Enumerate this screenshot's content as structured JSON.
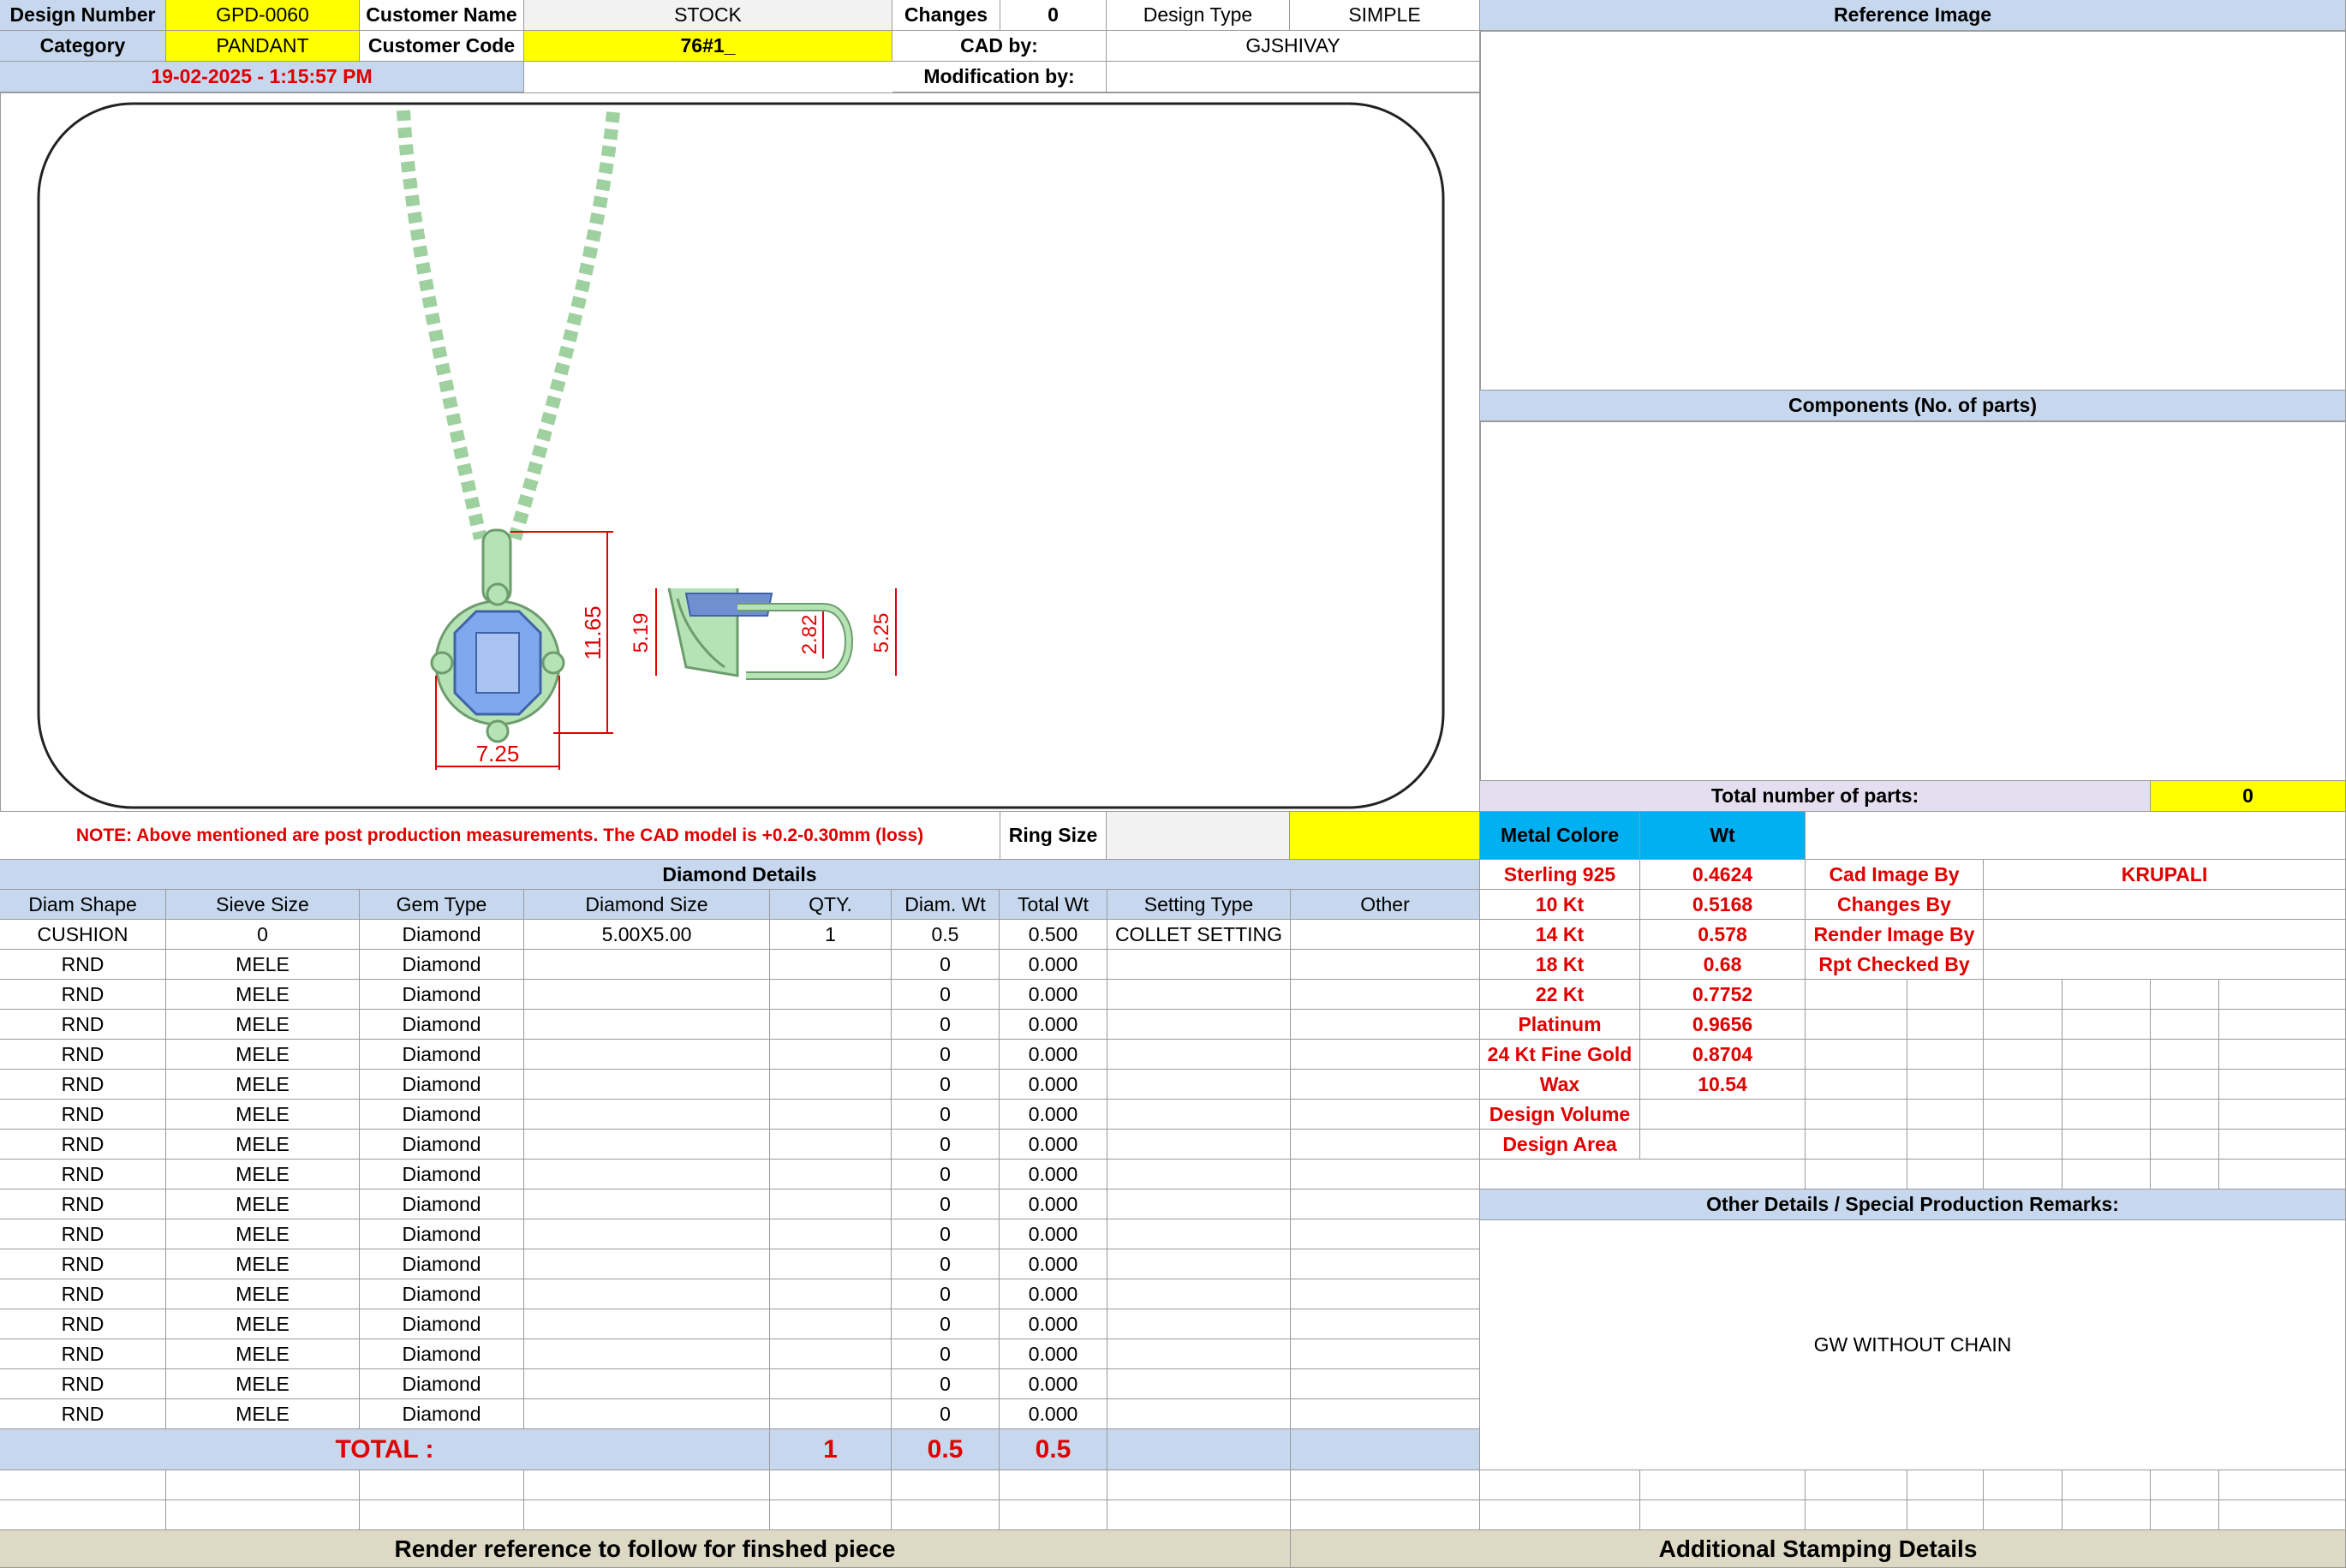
{
  "header": {
    "design_number_label": "Design Number",
    "design_number": "GPD-0060",
    "customer_name_label": "Customer Name",
    "customer_name": "STOCK",
    "changes_label": "Changes",
    "changes": "0",
    "design_type_label": "Design Type",
    "design_type": "SIMPLE",
    "category_label": "Category",
    "category": "PANDANT",
    "customer_code_label": "Customer Code",
    "customer_code": "76#1_",
    "cad_by_label": "CAD by:",
    "cad_by": "GJSHIVAY",
    "date": "19-02-2025 - 1:15:57 PM",
    "modification_by_label": "Modification by:"
  },
  "right_panel": {
    "reference_image_title": "Reference Image",
    "components_title": "Components (No. of parts)",
    "total_parts_label": "Total number of parts:",
    "total_parts": "0"
  },
  "measurements": {
    "width": "7.25",
    "height": "11.65",
    "side_height_left": "5.19",
    "side_inner": "2.82",
    "side_height_right": "5.25"
  },
  "note": "NOTE: Above mentioned are post production measurements. The CAD model is +0.2-0.30mm (loss)",
  "ring_size_label": "Ring Size",
  "diamond": {
    "title": "Diamond Details",
    "headers": [
      "Diam Shape",
      "Sieve Size",
      "Gem Type",
      "Diamond Size",
      "QTY.",
      "Diam. Wt",
      "Total Wt",
      "Setting Type",
      "Other"
    ],
    "rows": [
      [
        "CUSHION",
        "0",
        "Diamond",
        "5.00X5.00",
        "1",
        "0.5",
        "0.500",
        "COLLET SETTING",
        ""
      ],
      [
        "RND",
        "MELE",
        "Diamond",
        "",
        "",
        "0",
        "0.000",
        "",
        ""
      ],
      [
        "RND",
        "MELE",
        "Diamond",
        "",
        "",
        "0",
        "0.000",
        "",
        ""
      ],
      [
        "RND",
        "MELE",
        "Diamond",
        "",
        "",
        "0",
        "0.000",
        "",
        ""
      ],
      [
        "RND",
        "MELE",
        "Diamond",
        "",
        "",
        "0",
        "0.000",
        "",
        ""
      ],
      [
        "RND",
        "MELE",
        "Diamond",
        "",
        "",
        "0",
        "0.000",
        "",
        ""
      ],
      [
        "RND",
        "MELE",
        "Diamond",
        "",
        "",
        "0",
        "0.000",
        "",
        ""
      ],
      [
        "RND",
        "MELE",
        "Diamond",
        "",
        "",
        "0",
        "0.000",
        "",
        ""
      ],
      [
        "RND",
        "MELE",
        "Diamond",
        "",
        "",
        "0",
        "0.000",
        "",
        ""
      ],
      [
        "RND",
        "MELE",
        "Diamond",
        "",
        "",
        "0",
        "0.000",
        "",
        ""
      ],
      [
        "RND",
        "MELE",
        "Diamond",
        "",
        "",
        "0",
        "0.000",
        "",
        ""
      ],
      [
        "RND",
        "MELE",
        "Diamond",
        "",
        "",
        "0",
        "0.000",
        "",
        ""
      ],
      [
        "RND",
        "MELE",
        "Diamond",
        "",
        "",
        "0",
        "0.000",
        "",
        ""
      ],
      [
        "RND",
        "MELE",
        "Diamond",
        "",
        "",
        "0",
        "0.000",
        "",
        ""
      ],
      [
        "RND",
        "MELE",
        "Diamond",
        "",
        "",
        "0",
        "0.000",
        "",
        ""
      ],
      [
        "RND",
        "MELE",
        "Diamond",
        "",
        "",
        "0",
        "0.000",
        "",
        ""
      ],
      [
        "RND",
        "MELE",
        "Diamond",
        "",
        "",
        "0",
        "0.000",
        "",
        ""
      ]
    ],
    "total_label": "TOTAL :",
    "total_qty": "1",
    "total_diam_wt": "0.5",
    "total_wt": "0.5"
  },
  "metal": {
    "color_label": "Metal Colore",
    "wt_label": "Wt",
    "rows": [
      [
        "Sterling 925",
        "0.4624"
      ],
      [
        "10 Kt",
        "0.5168"
      ],
      [
        "14 Kt",
        "0.578"
      ],
      [
        "18 Kt",
        "0.68"
      ],
      [
        "22 Kt",
        "0.7752"
      ],
      [
        "Platinum",
        "0.9656"
      ],
      [
        "24 Kt Fine Gold",
        "0.8704"
      ],
      [
        "Wax",
        "10.54"
      ],
      [
        "Design Volume",
        ""
      ],
      [
        "Design Area",
        ""
      ]
    ]
  },
  "credits": {
    "cad_image_label": "Cad Image By",
    "cad_image": "KRUPALI",
    "changes_label": "Changes By",
    "render_label": "Render Image By",
    "rpt_label": "Rpt Checked By"
  },
  "remarks": {
    "title": "Other Details / Special Production Remarks:",
    "text": "GW WITHOUT CHAIN"
  },
  "footer": {
    "render_ref": "Render reference to follow for finshed piece",
    "stamping": "Additional Stamping Details"
  },
  "colors": {
    "yellow": "#ffff00",
    "header_blue": "#c7d8ee",
    "cyan": "#00b0f0",
    "red_text": "#e00000",
    "metal_green": "#b5e3b5",
    "diamond_blue": "#7fa8ee"
  }
}
